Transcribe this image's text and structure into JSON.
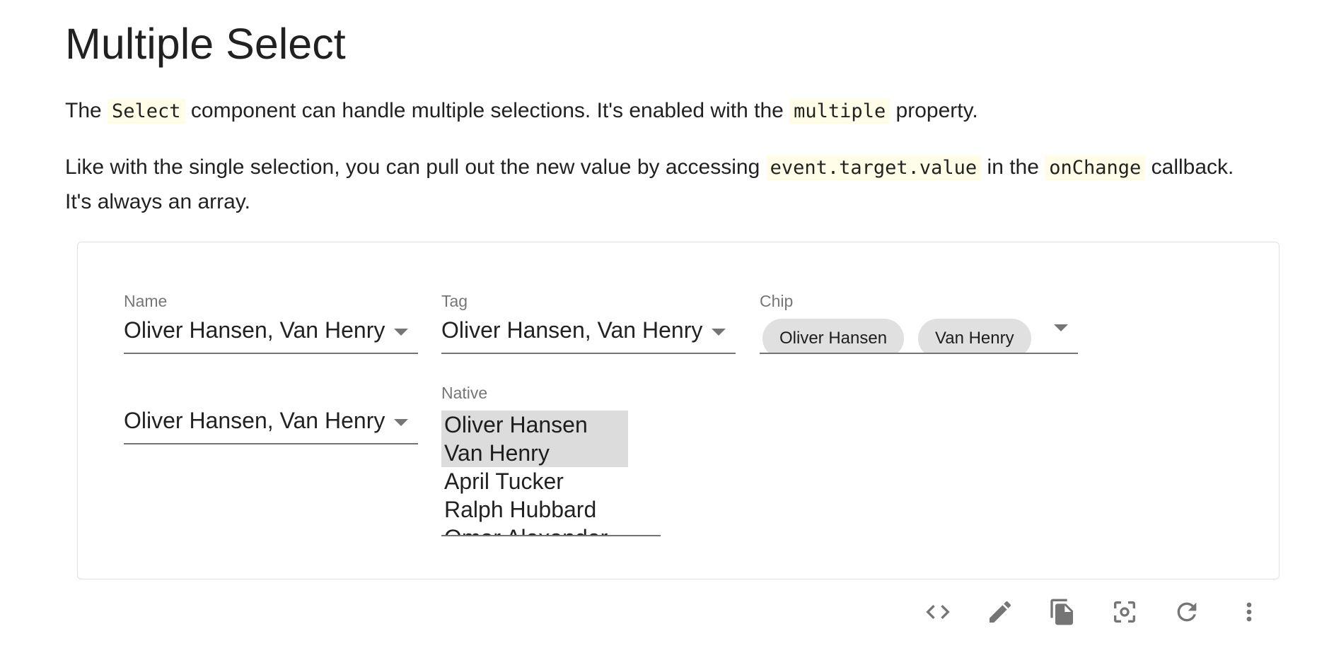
{
  "page": {
    "title": "Multiple Select",
    "para1": {
      "t1": "The ",
      "c1": "Select",
      "t2": " component can handle multiple selections. It's enabled with the ",
      "c2": "multiple",
      "t3": " property."
    },
    "para2": {
      "t1": "Like with the single selection, you can pull out the new value by accessing ",
      "c1": "event.target.value",
      "t2": " in the ",
      "c2": "onChange",
      "t3": " callback. It's always an array."
    }
  },
  "demo": {
    "name_field": {
      "label": "Name",
      "value": "Oliver Hansen, Van Henry"
    },
    "tag_field": {
      "label": "Tag",
      "value": "Oliver Hansen, Van Henry"
    },
    "chip_field": {
      "label": "Chip",
      "chips": [
        "Oliver Hansen",
        "Van Henry"
      ]
    },
    "placeholder_field": {
      "value": "Oliver Hansen, Van Henry"
    },
    "native_field": {
      "label": "Native",
      "options": [
        {
          "label": "Oliver Hansen",
          "selected": true
        },
        {
          "label": "Van Henry",
          "selected": true
        },
        {
          "label": "April Tucker",
          "selected": false
        },
        {
          "label": "Ralph Hubbard",
          "selected": false
        },
        {
          "label": "Omar Alexander",
          "selected": false
        }
      ]
    }
  },
  "toolbar": {
    "icons": [
      "code-icon",
      "edit-icon",
      "copy-icon",
      "screenshot-icon",
      "refresh-icon",
      "more-vert-icon"
    ]
  },
  "colors": {
    "code_bg": "#fffde7",
    "chip_bg": "#e0e0e0",
    "icon": "#757575",
    "selected_option_bg": "#dcdcdc"
  }
}
